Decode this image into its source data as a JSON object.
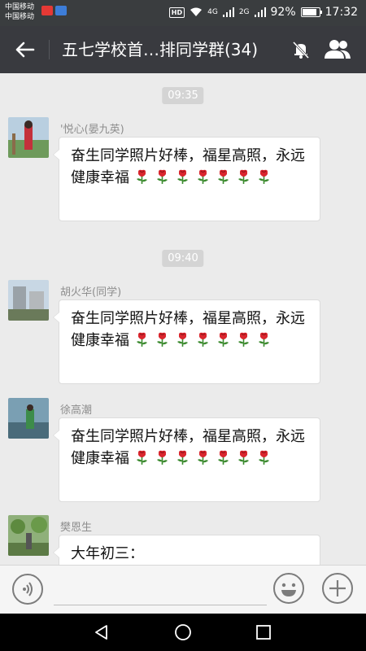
{
  "status_bar": {
    "carrier_1": "中国移动",
    "carrier_2": "中国移动",
    "hd": "HD",
    "net_1": "4G",
    "net_2": "2G",
    "battery_text": "92%",
    "battery_level": 0.92,
    "time": "17:32"
  },
  "header": {
    "title": "五七学校首…排同学群(34)",
    "back_icon": "arrow-left-icon",
    "mute_icon": "bell-off-icon",
    "members_icon": "group-icon"
  },
  "messages": [
    {
      "type": "time",
      "text": "09:35"
    },
    {
      "type": "msg",
      "sender": "'悦心(晏九英)",
      "text": "奋生同学照片好棒，福星高照，永远健康幸福",
      "roses": 7
    },
    {
      "type": "time",
      "text": "09:40"
    },
    {
      "type": "msg",
      "sender": "胡火华(同学)",
      "text": "奋生同学照片好棒，福星高照，永远健康幸福",
      "roses": 7
    },
    {
      "type": "msg",
      "sender": "徐高潮",
      "text": "奋生同学照片好棒，福星高照，永远健康幸福",
      "roses": 7
    },
    {
      "type": "msg",
      "sender": "樊恩生",
      "text": "大年初三："
    }
  ],
  "input_bar": {
    "voice_icon": "voice-icon",
    "emoji_icon": "emoji-icon",
    "plus_icon": "plus-icon",
    "input_value": ""
  },
  "nav_bar": {
    "back_icon": "triangle-back-icon",
    "home_icon": "circle-home-icon",
    "recent_icon": "square-recent-icon"
  },
  "colors": {
    "header_bg": "#393a3f",
    "chat_bg": "#ebebeb",
    "time_chip": "#d4d4d4"
  }
}
